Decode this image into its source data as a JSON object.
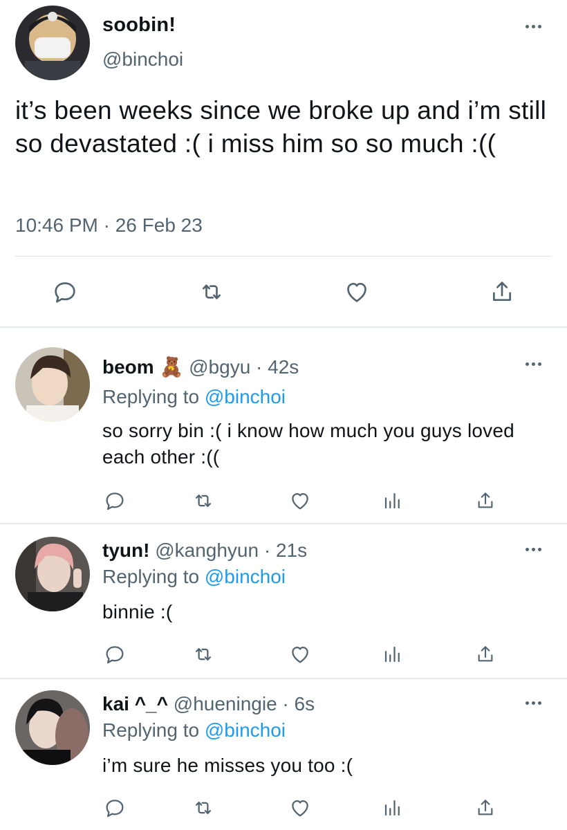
{
  "main_tweet": {
    "display_name": "soobin!",
    "handle": "@binchoi",
    "text": "it’s been weeks since we broke up and i’m still so devastated :( i miss him so so much :((",
    "timestamp": "10:46 PM · 26 Feb 23",
    "actions": [
      "reply-icon",
      "retweet-icon",
      "like-icon",
      "share-icon"
    ]
  },
  "replies": [
    {
      "display_name": "beom",
      "name_emoji": "🧸",
      "handle": "@bgyu",
      "time": "42s",
      "replying_prefix": "Replying to",
      "replying_to": "@binchoi",
      "text": "so sorry bin :( i know how much you guys loved each other :(("
    },
    {
      "display_name": "tyun!",
      "handle": "@kanghyun",
      "time": "21s",
      "replying_prefix": "Replying to",
      "replying_to": "@binchoi",
      "text": "binnie :("
    },
    {
      "display_name": "kai ^_^",
      "handle": "@hueningie",
      "time": "6s",
      "replying_prefix": "Replying to",
      "replying_to": "@binchoi",
      "text": "i’m sure he misses you too :("
    }
  ],
  "separator": "·",
  "colors": {
    "text": "#0f1419",
    "secondary": "#536471",
    "link": "#1d9bf0",
    "divider": "#e6e9eb"
  }
}
